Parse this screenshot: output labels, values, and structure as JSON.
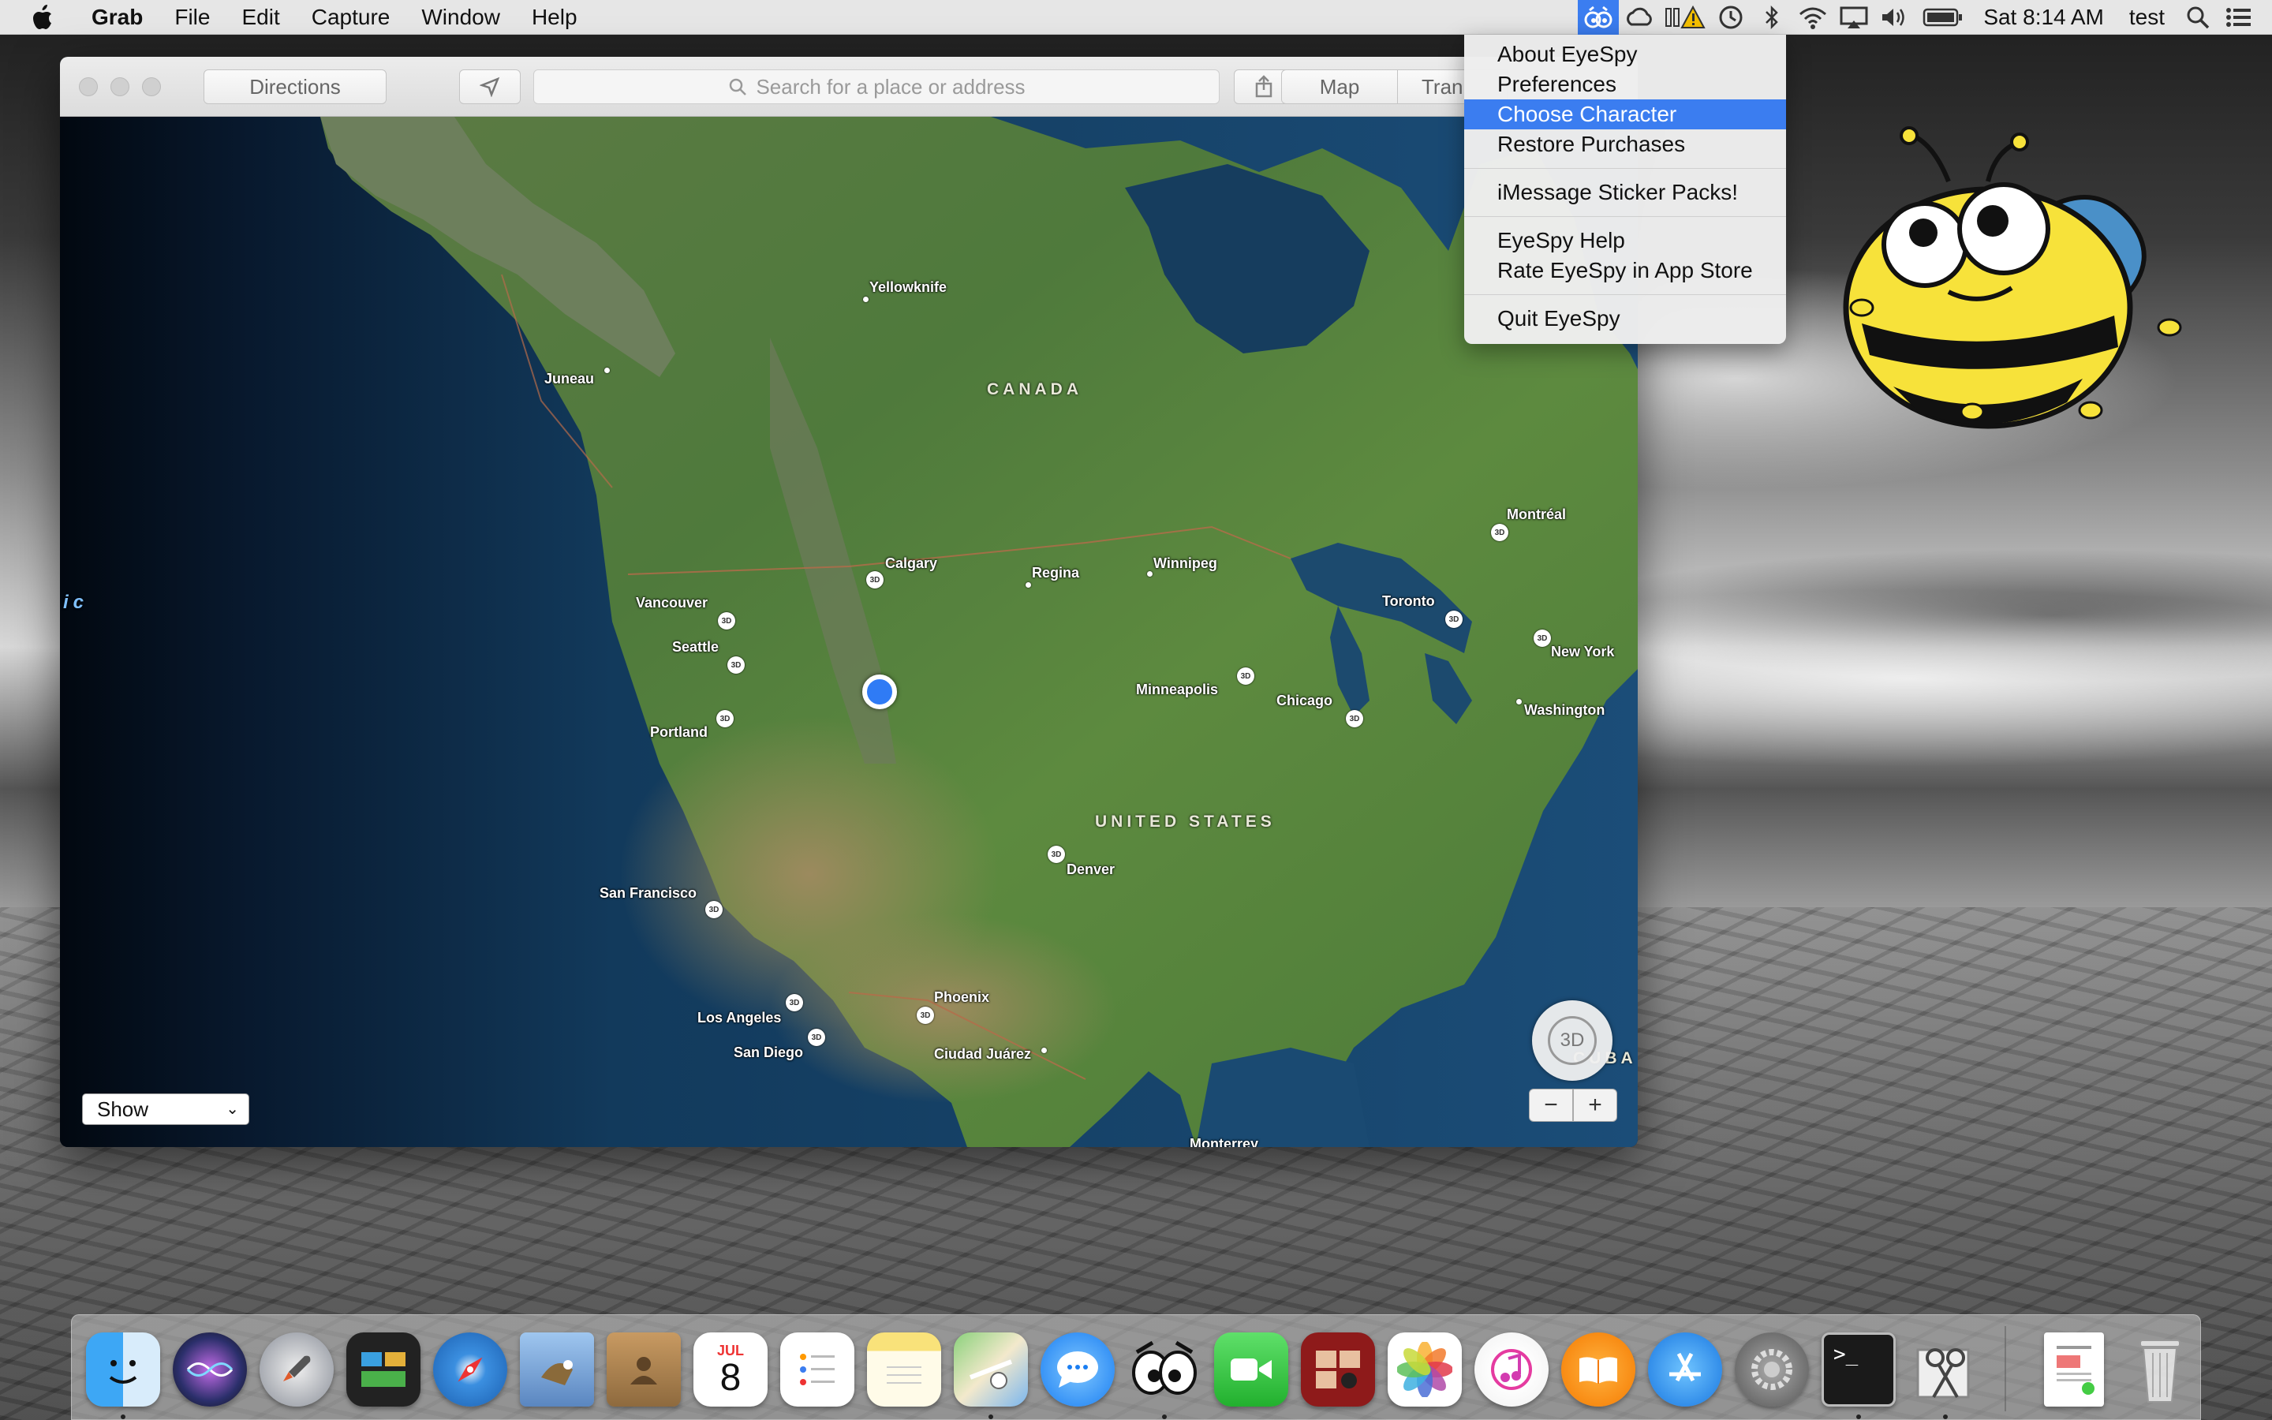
{
  "menubar": {
    "app_name": "Grab",
    "items": [
      "File",
      "Edit",
      "Capture",
      "Window",
      "Help"
    ],
    "clock": "Sat 8:14 AM",
    "user": "test",
    "tray_icons": [
      "eyespy-icon",
      "creative-cloud-icon",
      "bluetooth-warning-icon",
      "time-machine-icon",
      "bluetooth-icon",
      "wifi-icon",
      "airplay-icon",
      "volume-icon",
      "battery-icon"
    ]
  },
  "maps": {
    "directions_label": "Directions",
    "search_placeholder": "Search for a place or address",
    "map_tab": "Map",
    "transit_tab": "Tran",
    "show_label": "Show",
    "compass_label": "3D",
    "zoom_out": "−",
    "zoom_in": "+",
    "edge_label": "ic",
    "countries": [
      "CANADA",
      "UNITED STATES",
      "CUBA"
    ],
    "cities": {
      "yellowknife": "Yellowknife",
      "juneau": "Juneau",
      "calgary": "Calgary",
      "regina": "Regina",
      "winnipeg": "Winnipeg",
      "montreal": "Montréal",
      "vancouver": "Vancouver",
      "seattle": "Seattle",
      "toronto": "Toronto",
      "new_york": "New York",
      "portland": "Portland",
      "minneapolis": "Minneapolis",
      "chicago": "Chicago",
      "washington": "Washington",
      "denver": "Denver",
      "san_francisco": "San Francisco",
      "phoenix": "Phoenix",
      "los_angeles": "Los Angeles",
      "san_diego": "San Diego",
      "ciudad_juarez": "Ciudad Juárez",
      "monterrey": "Monterrey"
    },
    "pin_label": "3D"
  },
  "dropdown": {
    "items": [
      "About EyeSpy",
      "Preferences",
      "Choose Character",
      "Restore Purchases",
      "iMessage Sticker Packs!",
      "EyeSpy Help",
      "Rate EyeSpy in App Store",
      "Quit EyeSpy"
    ],
    "highlighted": "Choose Character"
  },
  "dock": {
    "calendar_month": "JUL",
    "calendar_day": "8",
    "terminal_prompt": ">_",
    "apps": [
      "finder-icon",
      "siri-icon",
      "launchpad-icon",
      "mission-control-icon",
      "safari-icon",
      "mail-icon",
      "contacts-icon",
      "calendar-icon",
      "reminders-icon",
      "notes-icon",
      "maps-icon",
      "messages-icon",
      "eyespy-icon",
      "facetime-icon",
      "photo-booth-icon",
      "photos-icon",
      "itunes-icon",
      "ibooks-icon",
      "app-store-icon",
      "system-preferences-icon",
      "terminal-icon",
      "grab-icon",
      "document-icon",
      "trash-icon"
    ]
  }
}
